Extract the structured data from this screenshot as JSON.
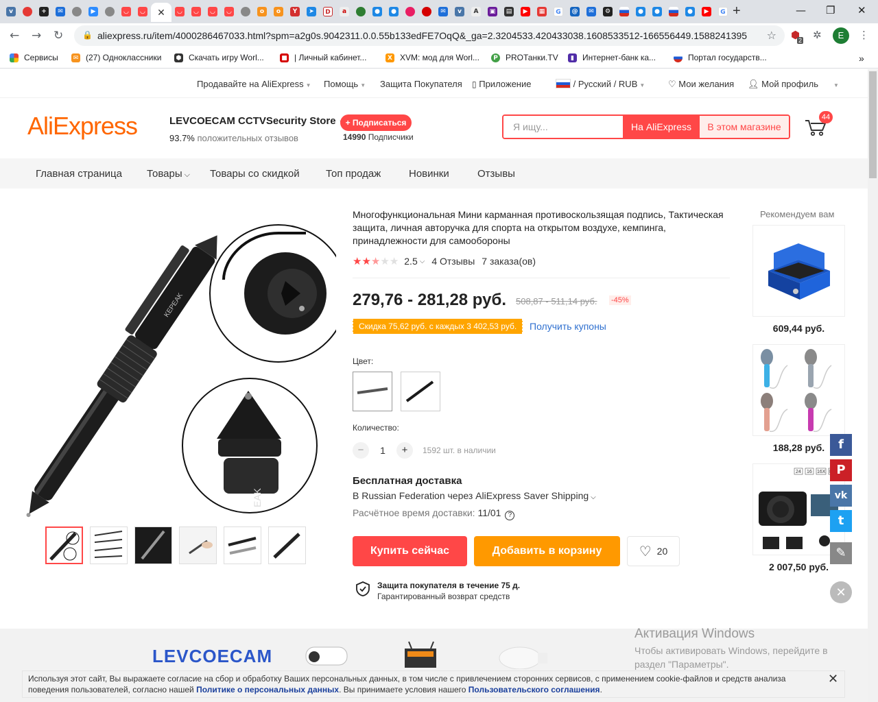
{
  "browser": {
    "active_tab_close": "✕",
    "new_tab": "+",
    "url": "aliexpress.ru/item/4000286467033.html?spm=a2g0s.9042311.0.0.55b133edFE7OqQ&_ga=2.3204533.420433038.1608533512-166556449.1588241395",
    "profile_initial": "E",
    "ext_badge": "2",
    "bookmarks": [
      {
        "label": "Сервисы"
      },
      {
        "label": "(27) Одноклассники"
      },
      {
        "label": "Скачать игру Worl..."
      },
      {
        "label": "| Личный кабинет..."
      },
      {
        "label": "XVM: мод для Worl..."
      },
      {
        "label": "PROТанки.TV"
      },
      {
        "label": "Интернет-банк ка..."
      },
      {
        "label": "Портал государств..."
      }
    ]
  },
  "topbar": {
    "sell": "Продавайте на AliExpress",
    "help": "Помощь",
    "protection": "Защита Покупателя",
    "app": "Приложение",
    "lang": "/ Русский /  RUB",
    "wishlist": "Мои желания",
    "profile": "Мой профиль"
  },
  "header": {
    "logo": "AliExpress",
    "store_name": "LEVCOECAM CCTVSecurity Store",
    "store_rating_pct": "93.7%",
    "store_rating_text": "положительных отзывов",
    "subscribe": "+ Подписаться",
    "subscribers_count": "14990",
    "subscribers_label": "Подписчики",
    "search_placeholder": "Я ищу...",
    "search_ae": "На AliExpress",
    "search_store": "В этом магазине",
    "cart_count": "44"
  },
  "storenav": [
    "Главная страница",
    "Товары",
    "Товары со скидкой",
    "Топ продаж",
    "Новинки",
    "Отзывы"
  ],
  "product": {
    "title": "Многофункциональная Мини карманная противоскользящая подпись, Тактическая защита, личная авторучка для спорта на открытом воздухе, кемпинга, принадлежности для самообороны",
    "rating_value": 2.5,
    "rating": "2.5",
    "reviews": "4 Отзывы",
    "orders": "7 заказа(ов)",
    "price": "279,76 - 281,28 руб.",
    "old_price": "508,87 - 511,14 руб.",
    "discount": "-45%",
    "coupon": "Скидка 75,62 руб. с каждых 3 402,53 руб.",
    "get_coupons": "Получить купоны",
    "color_label": "Цвет:",
    "qty_label": "Количество:",
    "qty_value": "1",
    "qty_minus": "−",
    "qty_plus": "+",
    "available": "1592 шт. в наличии",
    "free_shipping": "Бесплатная доставка",
    "shipping_via": "В Russian Federation через AliExpress Saver Shipping",
    "delivery_label": "Расчётное время доставки:",
    "delivery_date": "11/01",
    "buy_now": "Купить сейчас",
    "add_to_cart": "Добавить в корзину",
    "wish_count": "20",
    "protection_title": "Защита покупателя в течение 75 д.",
    "protection_sub": "Гарантированный возврат средств",
    "main_image_text": "KEPEAK",
    "main_image_text_2": "EAK"
  },
  "recommended": {
    "title": "Рекомендуем вам",
    "items": [
      {
        "price": "609,44 руб."
      },
      {
        "price": "188,28 руб."
      },
      {
        "price": "2 007,50 руб."
      }
    ],
    "camera_badges": [
      "24",
      "16",
      "16X",
      "MP"
    ]
  },
  "bottom": {
    "banner": "LEVCOECAM",
    "win_title": "Активация Windows",
    "win_text": "Чтобы активировать Windows, перейдите в раздел \"Параметры\".",
    "cookie_text_1": "Используя этот сайт, Вы выражаете согласие на сбор и обработку Ваших персональных данных, в том числе с привлечением сторонних сервисов, с применением cookie-файлов и средств анализа поведения пользователей, согласно нашей",
    "cookie_link_1": "Политике о персональных данных",
    "cookie_text_2": ". Вы принимаете условия нашего",
    "cookie_link_2": "Пользовательского соглашения",
    "cookie_text_3": ".",
    "cookie_close": "✕"
  },
  "colors": {
    "accent": "#ff4747",
    "orange": "#ff9900",
    "coupon": "#ffa500",
    "logo": "#ff6600"
  }
}
